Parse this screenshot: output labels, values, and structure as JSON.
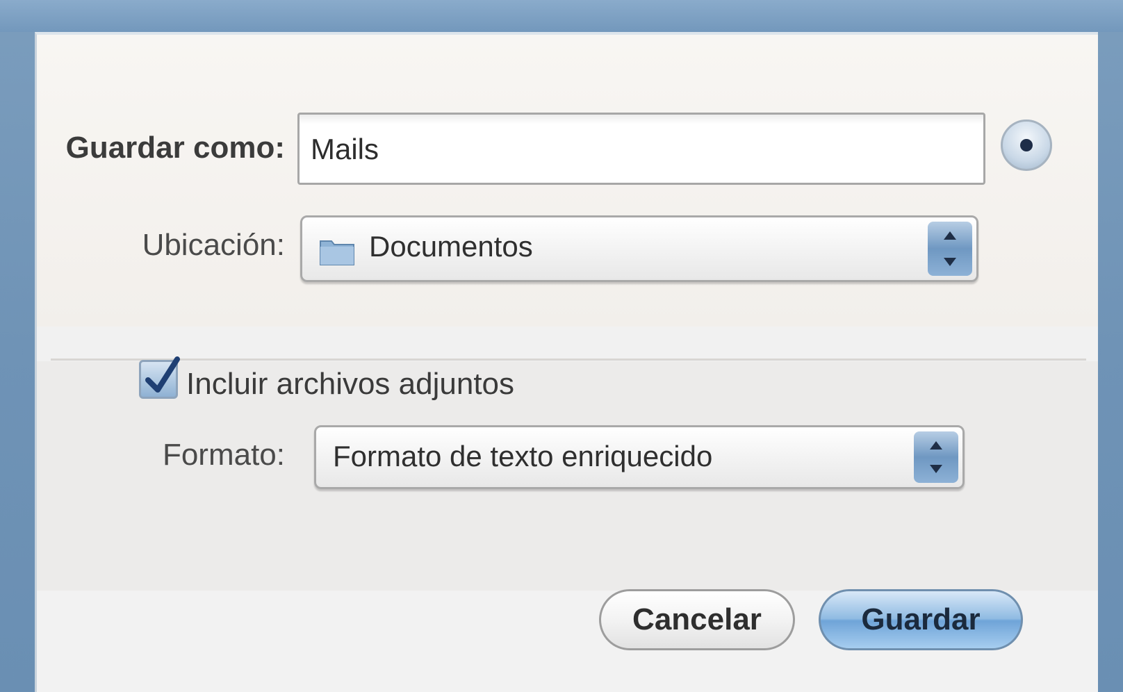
{
  "dialog": {
    "save_as_label": "Guardar como:",
    "file_name_value": "Mails",
    "where_label": "Ubicación:",
    "where_value": "Documentos",
    "include_attachments_label": "Incluir archivos adjuntos",
    "include_attachments_checked": true,
    "format_label": "Formato:",
    "format_value": "Formato de texto enriquecido",
    "cancel_label": "Cancelar",
    "save_label": "Guardar"
  },
  "icons": {
    "expand": "disclosure-icon",
    "folder": "folder-icon",
    "popup_arrows": "up-down-arrows-icon",
    "check": "checkmark-icon"
  },
  "colors": {
    "default_button": "#6fa4d8",
    "window_frame": "#6f93b6"
  }
}
